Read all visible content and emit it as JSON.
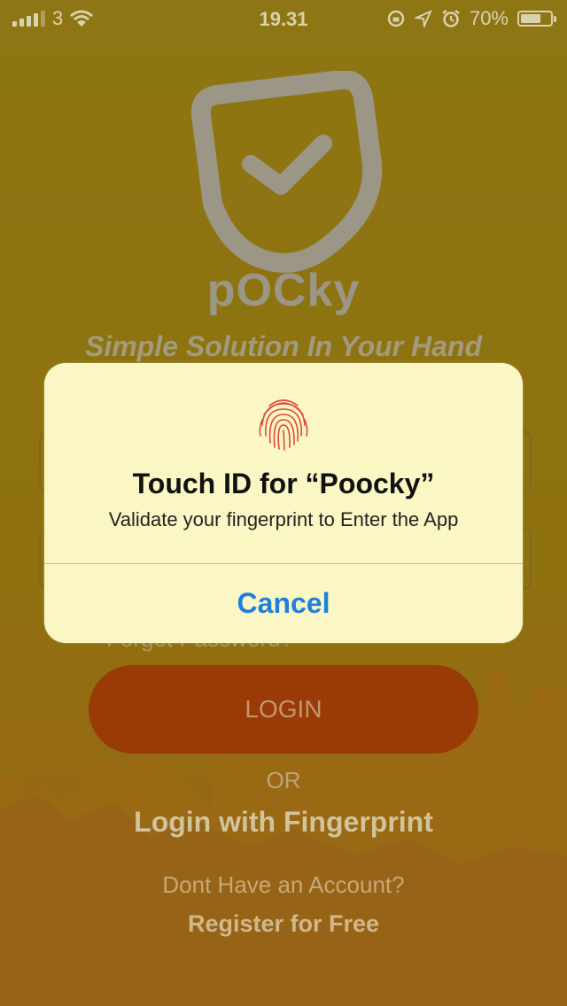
{
  "status_bar": {
    "carrier": "3",
    "time": "19.31",
    "battery": "70%",
    "battery_level": 0.7,
    "icons": [
      "signal-icon",
      "wifi-icon",
      "rotation-lock-icon",
      "location-icon",
      "alarm-icon",
      "battery-icon"
    ]
  },
  "app": {
    "brand": "pOCky",
    "tagline": "Simple Solution In Your Hand",
    "forgot_password": "Forget Password?",
    "login_label": "LOGIN",
    "or_label": "OR",
    "fingerprint_login": "Login with Fingerprint",
    "no_account": "Dont Have an Account?",
    "register": "Register for Free"
  },
  "dialog": {
    "title": "Touch ID for “Poocky”",
    "message": "Validate your fingerprint to Enter the App",
    "cancel_label": "Cancel"
  },
  "colors": {
    "overlay": "#8f7410",
    "login_button": "#9a3a07",
    "dialog_bg": "#fbf7c4",
    "cancel_text": "#1e7fe0",
    "fingerprint": "#e0473a"
  }
}
